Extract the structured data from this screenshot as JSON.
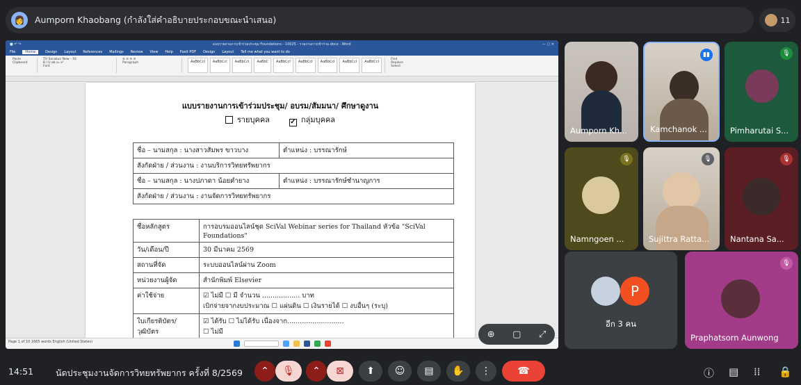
{
  "presenter_bar": {
    "presenter_name": "Aumporn Khaobang (กำลังใส่คำอธิบายประกอบขณะนำเสนอ)",
    "participant_count": "11"
  },
  "word": {
    "title_bar": "แบบรายงานการเข้าร่วมประชุม Foundations - 10025 - รายงานการเข้าร่วม.docx - Word",
    "tabs": [
      "File",
      "Home",
      "Design",
      "Layout",
      "References",
      "Mailings",
      "Review",
      "View",
      "Help",
      "Foxit PDF",
      "Design",
      "Layout"
    ],
    "tell_me": "Tell me what you want to do",
    "styles": [
      "AaBbCcI",
      "AaBbCcI",
      "AaBbCcI",
      "AaBbC",
      "AaBbCcI",
      "AaBbCcI",
      "AaBbCcI",
      "AaBbCcI",
      "AaBbCcI"
    ],
    "status": "Page 1 of 10   1665 words   English (United States)"
  },
  "document": {
    "heading": "แบบรายงานการเข้าร่วมประชุม/ อบรม/สัมมนา/ ศึกษาดูงาน",
    "option_individual": "รายบุคคล",
    "option_group": "กลุ่มบุคคล",
    "group_checked": "☑",
    "rows": [
      {
        "c1": "ชื่อ – นามสกุล  :  นางสาวสัมพร  ขาวบาง",
        "c2": "ตำแหน่ง : บรรณารักษ์"
      },
      {
        "c1": "สังกัดฝ่าย / ส่วนงาน :  งานบริการวิทยทรัพยากร",
        "c2": ""
      },
      {
        "c1": "ชื่อ – นามสกุล  :  นางปภาดา  น้อยคำยาง",
        "c2": "ตำแหน่ง : บรรณารักษ์ชำนาญการ"
      },
      {
        "c1": "สังกัดฝ่าย / ส่วนงาน :  งานจัดการวิทยทรัพยากร",
        "c2": ""
      }
    ],
    "course_label": "ชื่อหลักสูตร",
    "course_value": "การอบรมออนไลน์ชุด SciVal Webinar series for Thailand หัวข้อ \"SciVal Foundations\"",
    "date_label": "วัน/เดือน/ปี",
    "date_value": "30 มีนาคม 2569",
    "place_label": "สถานที่จัด",
    "place_value": "ระบบออนไลน์ผ่าน Zoom",
    "organizer_label": "หน่วยงานผู้จัด",
    "organizer_value": "สำนักพิมพ์ Elsevier",
    "cost_label": "ค่าใช้จ่าย",
    "cost_line1": "☑ ไม่มี          ☐ มี  จำนวน .................. บาท",
    "cost_line2": "เบิกจ่ายจากงบประมาณ ☐ แผ่นดิน  ☐ เงินรายได้  ☐ งบอื่นๆ (ระบุ)",
    "cert_label": "ใบเกียรติบัตร/ วุฒิบัตร",
    "cert_line1": "☑ ได้รับ          ☐ ไม่ได้รับ เนื่องจาก...........................",
    "cert_line2": "☐ ไม่มี"
  },
  "zoom_controls": {
    "zoom_in": "⊕",
    "frame": "▢",
    "expand": "⤢"
  },
  "tiles": [
    {
      "name": "Aumporn Kh...",
      "state": "video"
    },
    {
      "name": "Kamchanok ...",
      "state": "speaking"
    },
    {
      "name": "Pimharutai S...",
      "state": "muted"
    },
    {
      "name": "Namngoen ...",
      "state": "muted"
    },
    {
      "name": "Sujittra Ratta...",
      "state": "muted"
    },
    {
      "name": "Nantana Sa...",
      "state": "muted"
    },
    {
      "name": "อีก 3 คน",
      "state": "group"
    },
    {
      "name": "Praphatsorn Aunwong",
      "state": "muted"
    }
  ],
  "others_initial": "P",
  "bottom_bar": {
    "time": "14:51",
    "meeting_title": "นัดประชุมงานจัดการวิทยทรัพยากร ครั้งที่ 8/2569"
  },
  "colors": {
    "background": "#202124",
    "tile": "#3c4043",
    "end_call": "#ea4335",
    "speaking": "#1a73e8",
    "others_avatar": "#f25022",
    "praphatsorn_tile": "#a23b88"
  }
}
